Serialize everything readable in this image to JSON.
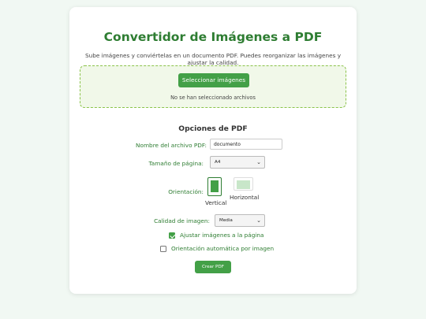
{
  "app": {
    "title": "Convertidor de Imágenes a PDF",
    "subtitle": "Sube imágenes y conviértelas en un documento PDF. Puedes reorganizar las imágenes y ajustar la calidad."
  },
  "upload": {
    "select_button": "Seleccionar imágenes",
    "status": "No se han seleccionado archivos"
  },
  "options": {
    "title": "Opciones de PDF",
    "filename_label": "Nombre del archivo PDF:",
    "filename_value": "documento",
    "page_size_label": "Tamaño de página:",
    "page_size_value": "A4",
    "orientation_label": "Orientación:",
    "orientation_vertical": "Vertical",
    "orientation_horizontal": "Horizontal",
    "orientation_selected": "Vertical",
    "quality_label": "Calidad de imagen:",
    "quality_value": "Media",
    "fit_images_label": "Ajustar imágenes a la página",
    "fit_images_checked": true,
    "auto_orientation_label": "Orientación automática por imagen",
    "auto_orientation_checked": false,
    "create_button": "Crear PDF"
  },
  "colors": {
    "accent": "#43a047",
    "heading": "#2e7d32",
    "background": "#f1f8f3",
    "dropzone": "#f1f8e9"
  },
  "icons": {
    "select_chevron": "chevron-down-icon",
    "vertical": "portrait-page-icon",
    "horizontal": "landscape-page-icon"
  }
}
